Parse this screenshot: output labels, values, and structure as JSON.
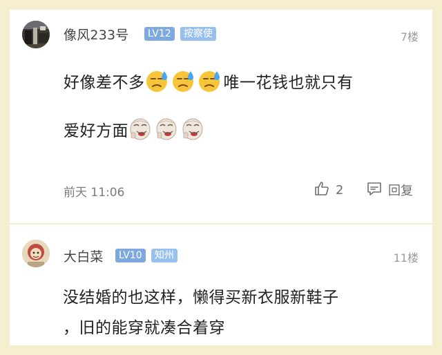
{
  "comments": [
    {
      "username": "像风233号",
      "level": "LV12",
      "role": "按察使",
      "floor": "7楼",
      "line1_pre": "好像差不多",
      "line1_post": "唯一花钱也就只有",
      "line2_pre": "爱好方面",
      "emoji_a": "sweat-face-icon",
      "emoji_b": "laughing-meme-face-icon",
      "time": "前天 11:06",
      "likes": "2",
      "reply_label": "回复"
    },
    {
      "username": "大白菜",
      "level": "LV10",
      "role": "知州",
      "floor": "11楼",
      "line1": "没结婚的也这样，懒得买新衣服新鞋子",
      "line2": "，旧的能穿就凑合着穿"
    }
  ]
}
